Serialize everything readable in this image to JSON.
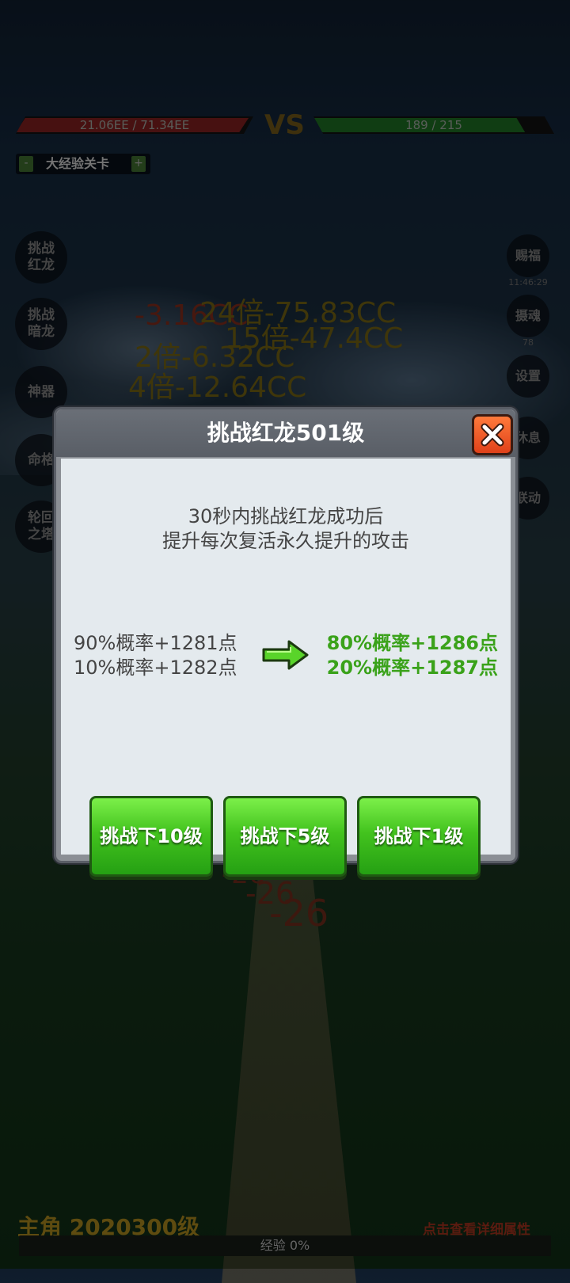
{
  "top": {
    "player_hp": "21.06EE / 71.34EE",
    "player_hp_fraction": 0.98,
    "vs": "VS",
    "enemy_hp": "189 / 215",
    "enemy_hp_fraction": 0.879,
    "stage_minus": "-",
    "stage_label": "大经验关卡",
    "stage_plus": "+"
  },
  "left_menu": {
    "items": [
      {
        "label": "挑战\n红龙"
      },
      {
        "label": "挑战\n暗龙"
      },
      {
        "label": "神器"
      },
      {
        "label": "命格"
      },
      {
        "label": "轮回\n之塔"
      }
    ]
  },
  "right_menu": {
    "blessing": "赐福",
    "blessing_timer": "11:46:29",
    "soul": "摄魂",
    "soul_count": "78",
    "settings": "设置",
    "rest": "休息",
    "link": "联动"
  },
  "damage_numbers": {
    "d1": "-3.16CC",
    "d2": "24倍-75.83CC",
    "d3": "15倍-47.4CC",
    "d4": "2倍-6.32CC",
    "d5": "4倍-12.64CC",
    "d6": "-26",
    "d7": "-26",
    "d8": "-26"
  },
  "dialog": {
    "title": "挑战红龙501级",
    "desc_line1": "30秒内挑战红龙成功后",
    "desc_line2": "提升每次复活永久提升的攻击",
    "current_line1": "90%概率+1281点",
    "current_line2": "10%概率+1282点",
    "next_line1": "80%概率+1286点",
    "next_line2": "20%概率+1287点",
    "buttons": [
      "挑战下10级",
      "挑战下5级",
      "挑战下1级"
    ]
  },
  "bottom": {
    "hero": "主角 2020300级",
    "detail_link": "点击查看详细属性",
    "exp": "经验 0%"
  },
  "colors": {
    "accent_green": "#3aa21a",
    "close_red": "#e0411a",
    "button_green": "#43c31e"
  }
}
